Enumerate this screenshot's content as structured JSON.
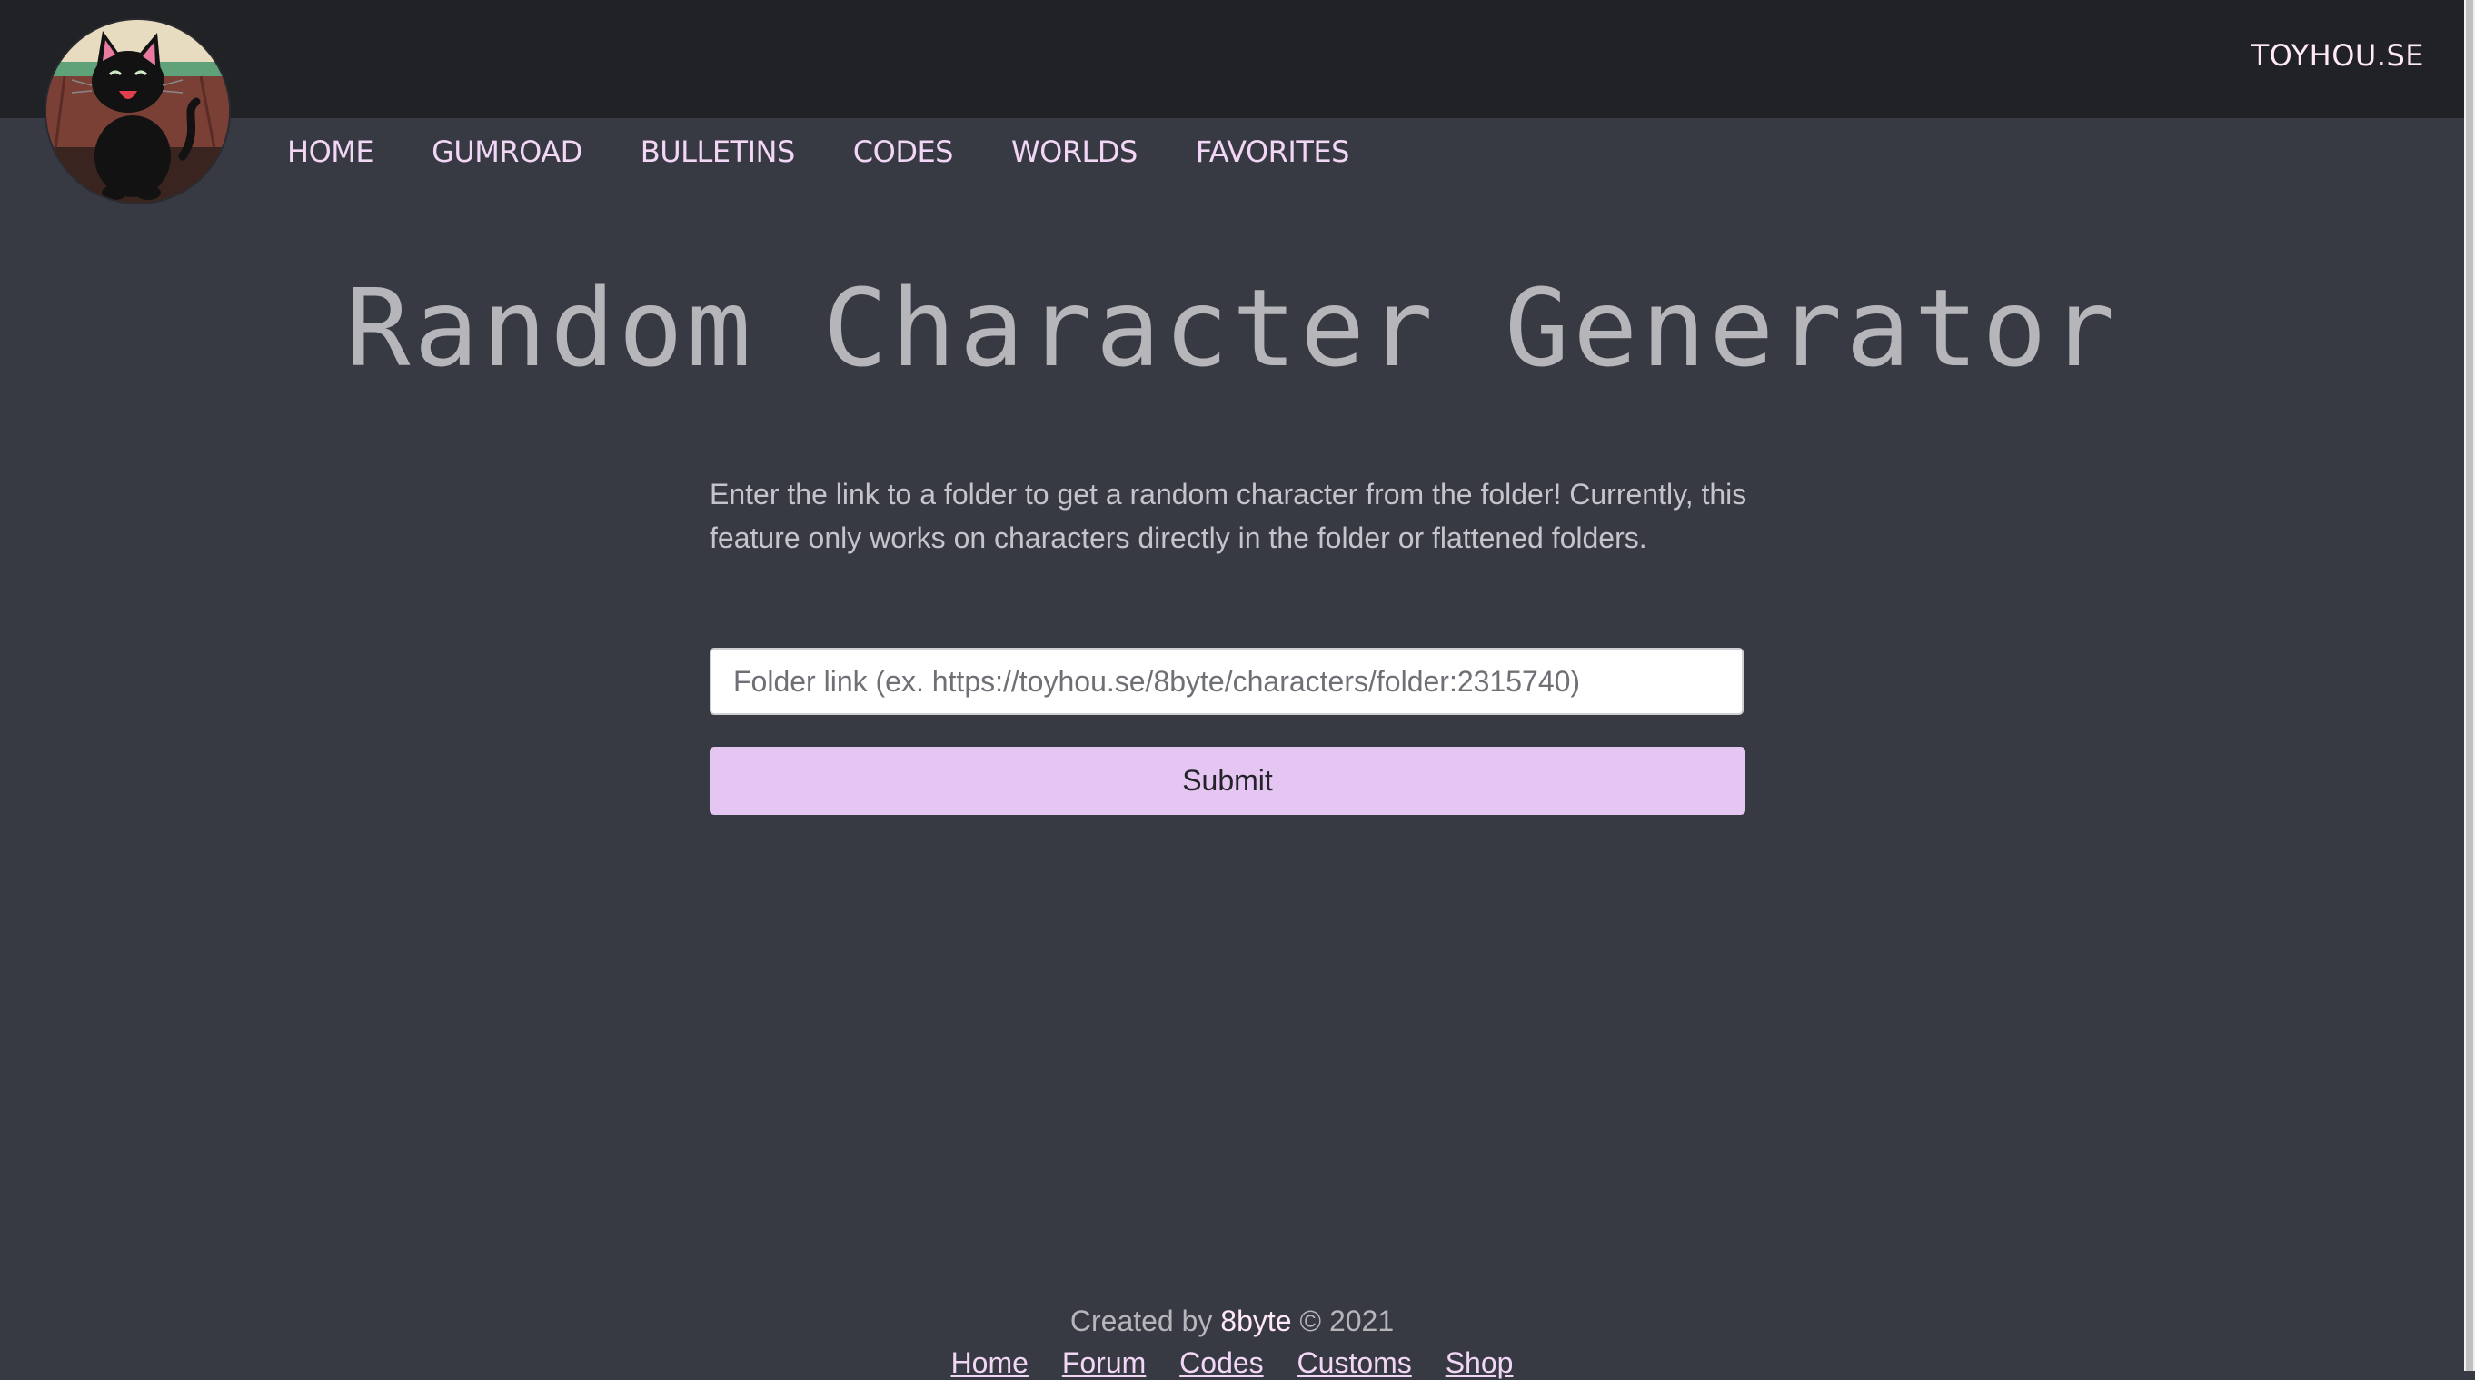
{
  "header": {
    "site_link": "TOYHOU.SE",
    "avatar_icon": "black-cat-avatar-icon"
  },
  "nav": {
    "items": [
      {
        "label": "HOME"
      },
      {
        "label": "GUMROAD"
      },
      {
        "label": "BULLETINS"
      },
      {
        "label": "CODES"
      },
      {
        "label": "WORLDS"
      },
      {
        "label": "FAVORITES"
      }
    ]
  },
  "main": {
    "title": "Random Character Generator",
    "description": "Enter the link to a folder to get a random character from the folder! Currently, this feature only works on characters directly in the folder or flattened folders.",
    "input_placeholder": "Folder link (ex. https://toyhou.se/8byte/characters/folder:2315740)",
    "input_value": "",
    "submit_label": "Submit"
  },
  "footer": {
    "created_prefix": "Created by",
    "author": "8byte",
    "copyright": "© 2021",
    "links": [
      "Home",
      "Forum",
      "Codes",
      "Customs",
      "Shop"
    ]
  },
  "colors": {
    "page_background": "#373943",
    "topbar_background": "#212226",
    "accent": "#e5c5f2",
    "nav_text": "#f2d6f5"
  }
}
